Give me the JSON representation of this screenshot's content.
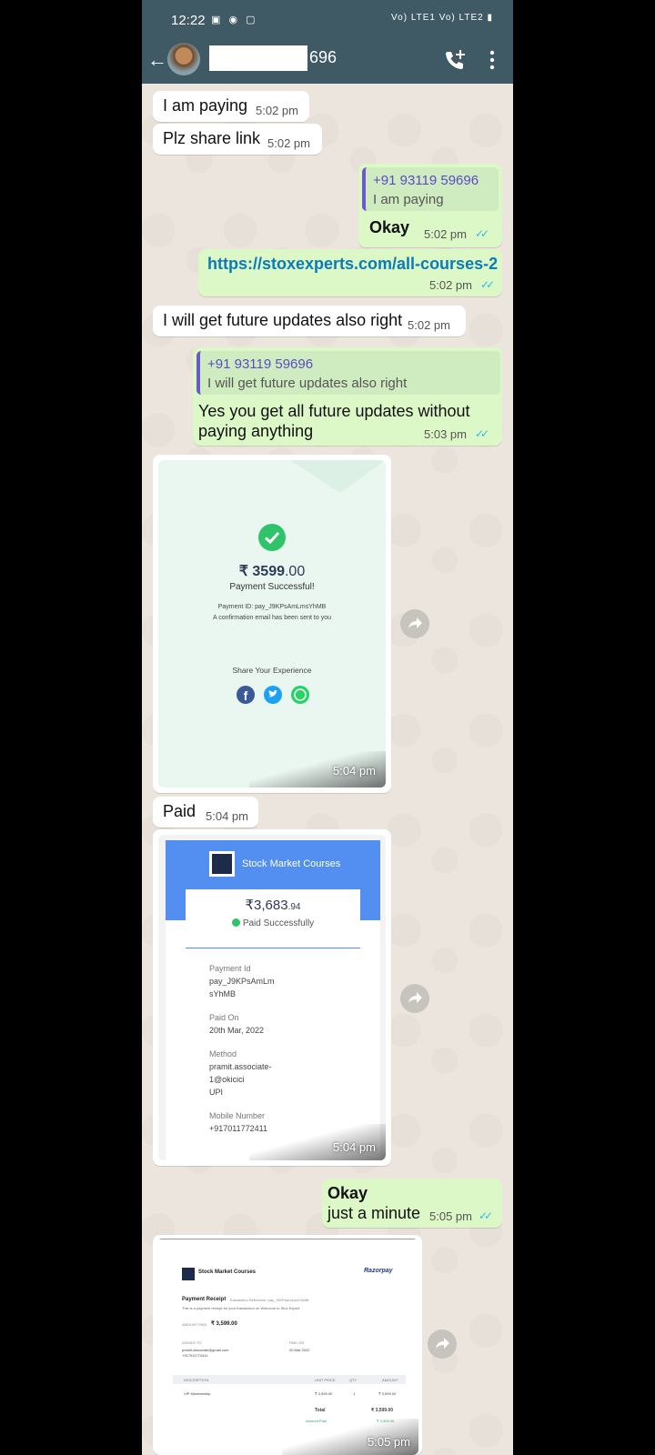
{
  "status_bar": {
    "time": "12:22",
    "network": "Vo) LTE1 Vo) LTE2"
  },
  "header": {
    "contact_name_suffix": "696"
  },
  "messages": {
    "m1": {
      "text": "I am paying",
      "time": "5:02 pm"
    },
    "m2": {
      "text": "Plz share link",
      "time": "5:02 pm"
    },
    "m3": {
      "quote_name": "+91 93119 59696",
      "quote_text": "I am paying",
      "text": "Okay",
      "time": "5:02 pm"
    },
    "m4": {
      "link": "https://stoxexperts.com/all-courses-2",
      "time": "5:02 pm"
    },
    "m5": {
      "text": "I will get future updates also right",
      "time": "5:02 pm"
    },
    "m6": {
      "quote_name": "+91 93119 59696",
      "quote_text": "I will get future updates also right",
      "line1": "Yes you get all future updates without",
      "line2": "paying anything",
      "time": "5:03 pm"
    },
    "img1": {
      "amount_main": "₹ 3599",
      "amount_dec": ".00",
      "status": "Payment Successful!",
      "payment_id": "Payment ID: pay_J9KPsAmLmsYhMB",
      "email_note": "A confirmation email has been sent to you",
      "share": "Share Your Experience",
      "time": "5:04 pm"
    },
    "m7": {
      "text": "Paid",
      "time": "5:04 pm"
    },
    "img2": {
      "brand": "Stock Market Courses",
      "amount_main": "₹3,683",
      "amount_dec": ".94",
      "paid": "Paid Successfully",
      "payment_id_label": "Payment Id",
      "payment_id_l1": "pay_J9KPsAmLm",
      "payment_id_l2": "sYhMB",
      "paid_on_label": "Paid On",
      "paid_on": "20th Mar, 2022",
      "method_label": "Method",
      "method_l1": "pramit.associate-",
      "method_l2": "1@okicici",
      "method_l3": "UPI",
      "mobile_label": "Mobile Number",
      "mobile": "+917011772411",
      "time": "5:04 pm"
    },
    "m8": {
      "line1": "Okay",
      "line2": "just a minute",
      "time": "5:05 pm"
    },
    "img3": {
      "brand": "Stock Market Courses",
      "razorpay": "Razorpay",
      "receipt_title": "Payment Receipt",
      "receipt_ref": "Transaction Reference: pay_J9KPsAmLmsYhMB",
      "receipt_note": "This is a payment receipt for your transaction on Welcome to Stox Expert",
      "amount_label": "AMOUNT PAID",
      "amount": "₹ 3,599.00",
      "issued_label": "ISSUED TO",
      "issued_email": "pramit.associate@gmail.com",
      "issued_phone": "+917011772411",
      "paid_on_label": "PAID ON",
      "paid_on": "20 Mar 2022",
      "col_desc": "DESCRIPTION",
      "col_price": "UNIT PRICE",
      "col_qty": "QTY",
      "col_amount": "AMOUNT",
      "item": "VIP Membership",
      "item_price": "₹ 3,599.00",
      "item_qty": "1",
      "item_amount": "₹ 3,599.00",
      "total_label": "Total",
      "total": "₹ 3,599.00",
      "amount_paid_label": "Amount Paid",
      "amount_paid": "₹ 3,599.00",
      "time": "5:05 pm"
    }
  },
  "colors": {
    "header": "#3F5A65",
    "outgoing": "#DCF8C6",
    "incoming": "#FFFFFF",
    "wallpaper": "#ECE5DD",
    "ticks": "#34B7F1",
    "link": "#0A7BB5"
  }
}
